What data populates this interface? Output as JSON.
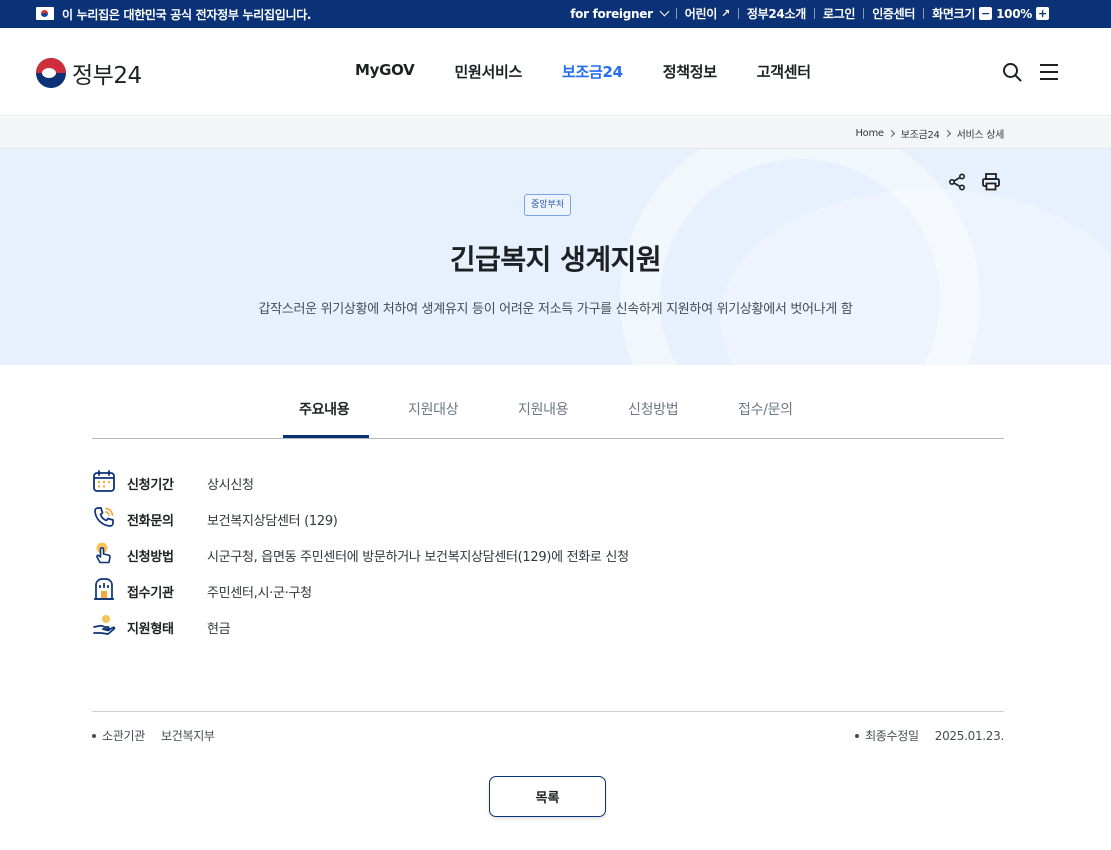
{
  "gov_banner": {
    "notice": "이 누리집은 대한민국 공식 전자정부 누리집입니다.",
    "foreigner": "for foreigner",
    "kids": "어린이",
    "about": "정부24소개",
    "login": "로그인",
    "cert_center": "인증센터",
    "screen_size": "화면크기",
    "zoom_minus": "−",
    "zoom_level": "100%",
    "zoom_plus": "+"
  },
  "header": {
    "logo_text": "정부24",
    "nav": [
      "MyGOV",
      "민원서비스",
      "보조금24",
      "정책정보",
      "고객센터"
    ],
    "active_nav": "보조금24"
  },
  "breadcrumb": [
    "Home",
    "보조금24",
    "서비스 상세"
  ],
  "hero": {
    "badge": "중앙부처",
    "title": "긴급복지 생계지원",
    "description": "갑작스러운 위기상황에 처하여 생계유지 등이 어려운 저소득 가구를 신속하게 지원하여 위기상황에서 벗어나게 함"
  },
  "tabs": [
    "주요내용",
    "지원대상",
    "지원내용",
    "신청방법",
    "접수/문의"
  ],
  "info": [
    {
      "icon": "calendar-icon",
      "label": "신청기간",
      "value": "상시신청"
    },
    {
      "icon": "phone-icon",
      "label": "전화문의",
      "value": "보건복지상담센터 (129)"
    },
    {
      "icon": "touch-icon",
      "label": "신청방법",
      "value": "시군구청, 읍면동 주민센터에 방문하거나 보건복지상담센터(129)에 전화로 신청"
    },
    {
      "icon": "building-icon",
      "label": "접수기관",
      "value": "주민센터,시·군·구청"
    },
    {
      "icon": "hand-coin-icon",
      "label": "지원형태",
      "value": "현금"
    }
  ],
  "meta": {
    "org_label": "소관기관",
    "org_value": "보건복지부",
    "updated_label": "최종수정일",
    "updated_value": "2025.01.23."
  },
  "list_button": "목록",
  "colors": {
    "gov_bar": "#0b3276",
    "active_nav": "#256ef4",
    "hero_bg": "#e7f0fd",
    "accent": "#0b3276"
  }
}
